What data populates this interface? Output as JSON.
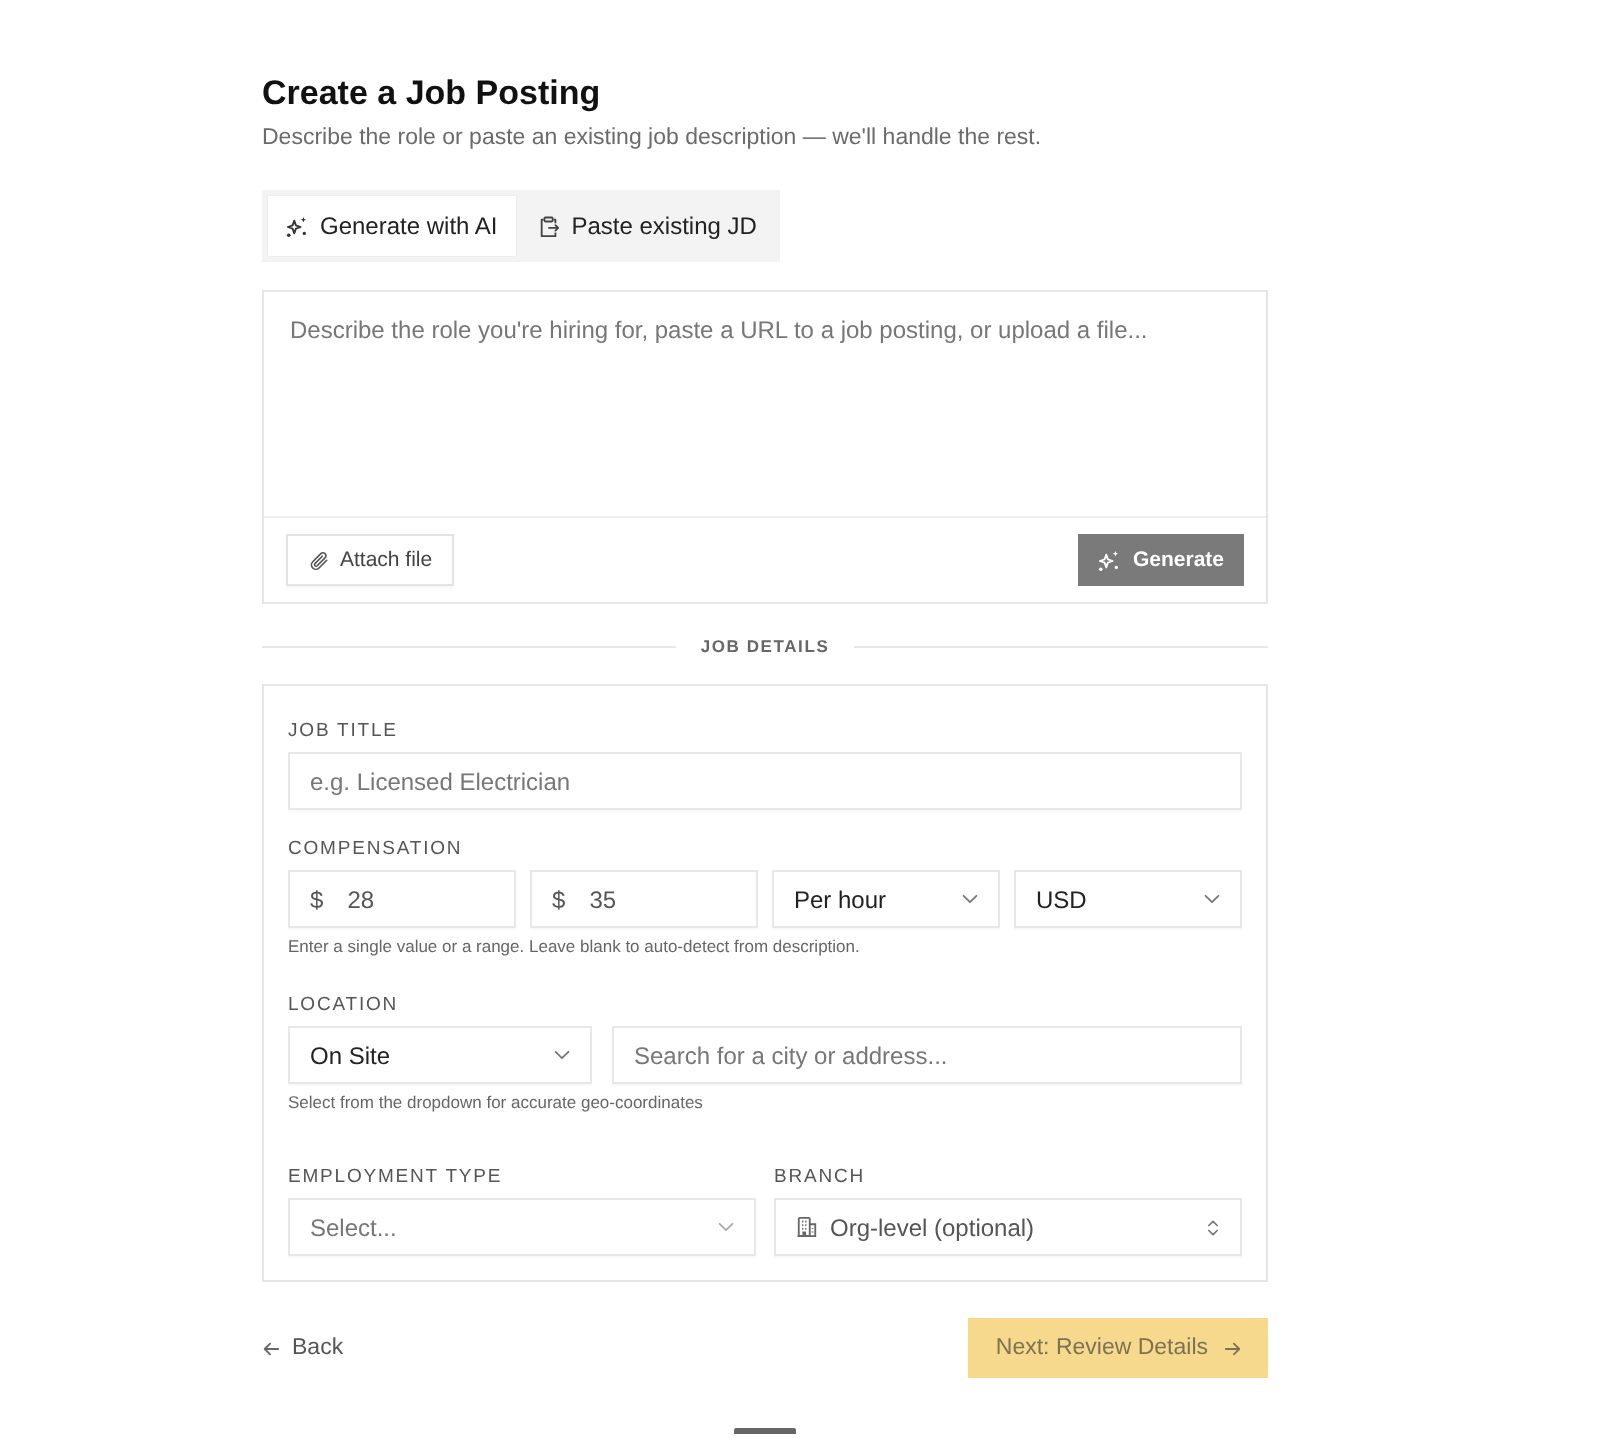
{
  "header": {
    "title": "Create a Job Posting",
    "subtitle": "Describe the role or paste an existing job description — we'll handle the rest."
  },
  "tabs": [
    {
      "label": "Generate with AI",
      "kind": "sparkle",
      "selected": true
    },
    {
      "label": "Paste existing JD",
      "kind": "paste",
      "selected": false
    }
  ],
  "composer": {
    "placeholder": "Describe the role you're hiring for, paste a URL to a job posting, or upload a file...",
    "attach_button": "Attach file",
    "generate_button": {
      "label": "Generate",
      "disabled": true
    }
  },
  "section_divider": "JOB DETAILS",
  "job_title": {
    "label": "JOB TITLE",
    "placeholder": "e.g. Licensed Electrician"
  },
  "compensation": {
    "label": "COMPENSATION",
    "fields": [
      {
        "kind": "amount",
        "prefix": "$",
        "value": "28"
      },
      {
        "kind": "amount",
        "prefix": "$",
        "value": "35"
      },
      {
        "kind": "select",
        "value": "Per hour"
      },
      {
        "kind": "select",
        "value": "USD"
      }
    ],
    "hint": "Enter a single value or a range. Leave blank to auto-detect from description."
  },
  "location": {
    "label": "LOCATION",
    "type_select": {
      "value": "On Site"
    },
    "search": {
      "placeholder": "Search for a city or address..."
    },
    "hint": "Select from the dropdown for accurate geo-coordinates"
  },
  "employment_type": {
    "label": "EMPLOYMENT TYPE",
    "placeholder": "Select..."
  },
  "branch": {
    "label": "BRANCH",
    "placeholder": "Org-level (optional)"
  },
  "footer": {
    "back_button": "Back",
    "next_button": {
      "label": "Next: Review Details",
      "disabled": true
    }
  }
}
